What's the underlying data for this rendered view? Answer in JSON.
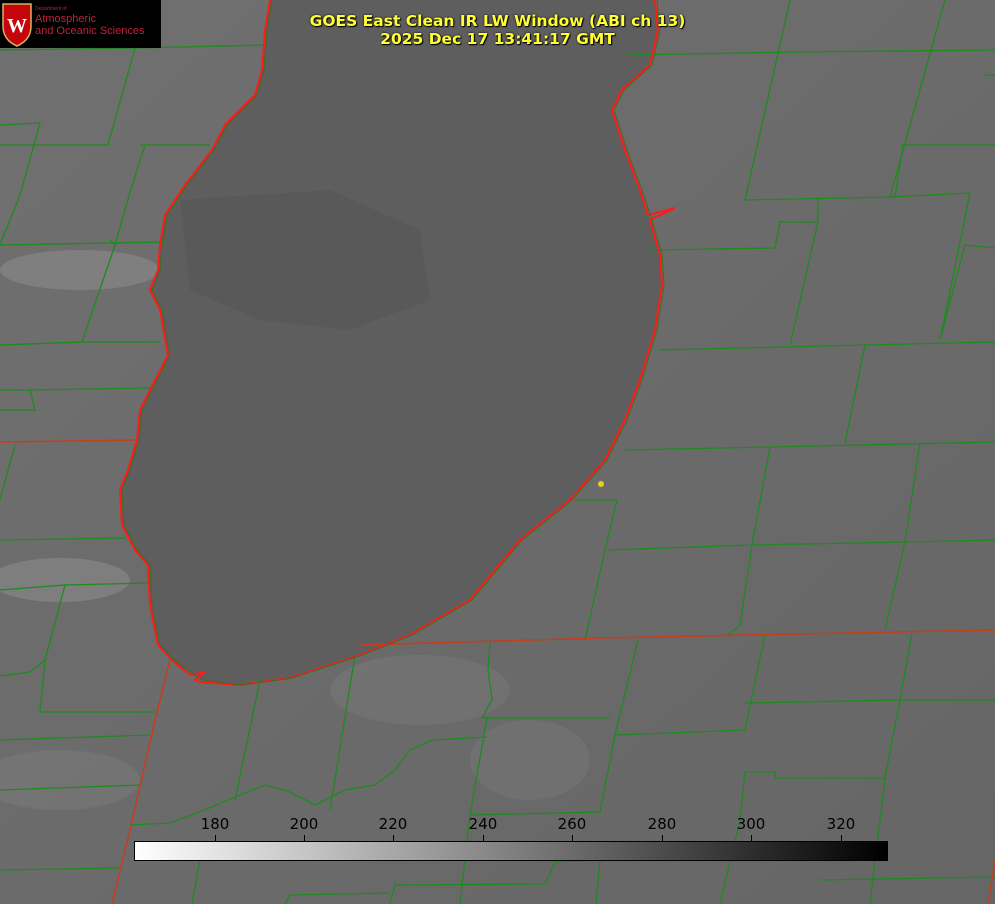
{
  "logo": {
    "department": "Department of",
    "line1": "Atmospheric",
    "line2": "and Oceanic Sciences",
    "letter": "W"
  },
  "title": {
    "line1": "GOES East Clean IR LW Window (ABI ch 13)",
    "line2": "2025 Dec 17 13:41:17 GMT"
  },
  "colorbar": {
    "ticks": [
      "180",
      "200",
      "220",
      "240",
      "260",
      "280",
      "300",
      "320"
    ],
    "gradient_start": "#ffffff",
    "gradient_end": "#000000"
  },
  "colors": {
    "title": "#ffff33",
    "county_lines": "#1f8a1f",
    "state_lines": "#c0401f",
    "lake_outline": "#ff1a1a",
    "lake_fill": "#5e5e5e",
    "land_background": "#6b6b6b",
    "marker": "#e6d11a",
    "logo_crest": "#c5050c"
  }
}
